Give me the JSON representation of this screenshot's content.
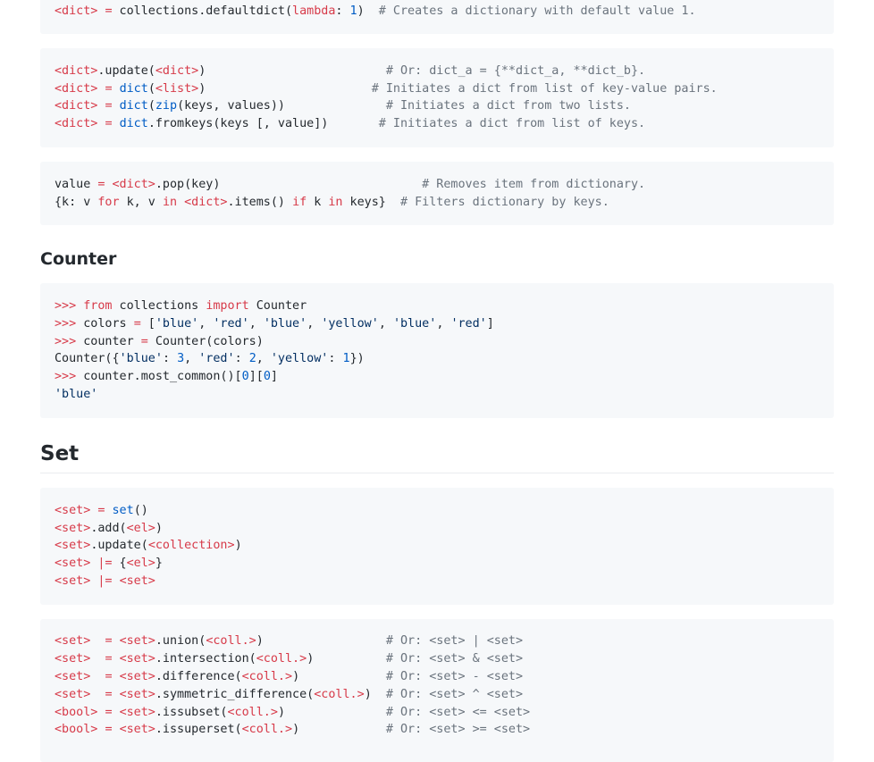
{
  "blocks": [
    {
      "name": "defaultdict-block",
      "lines": [
        [
          [
            "k",
            "<dict>"
          ],
          [
            "p",
            " "
          ],
          [
            "k",
            "="
          ],
          [
            "p",
            " collections.defaultdict("
          ],
          [
            "k",
            "lambda"
          ],
          [
            "p",
            ": "
          ],
          [
            "n",
            "1"
          ],
          [
            "p",
            ")  "
          ],
          [
            "c",
            "# Creates a dictionary with default value 1."
          ]
        ]
      ]
    },
    {
      "name": "dict-update-block",
      "lines": [
        [
          [
            "k",
            "<dict>"
          ],
          [
            "p",
            ".update("
          ],
          [
            "k",
            "<dict>"
          ],
          [
            "p",
            ")                         "
          ],
          [
            "c",
            "# Or: dict_a = {**dict_a, **dict_b}."
          ]
        ],
        [
          [
            "k",
            "<dict>"
          ],
          [
            "p",
            " "
          ],
          [
            "k",
            "="
          ],
          [
            "p",
            " "
          ],
          [
            "n",
            "dict"
          ],
          [
            "p",
            "("
          ],
          [
            "k",
            "<list>"
          ],
          [
            "p",
            ")                       "
          ],
          [
            "c",
            "# Initiates a dict from list of key-value pairs."
          ]
        ],
        [
          [
            "k",
            "<dict>"
          ],
          [
            "p",
            " "
          ],
          [
            "k",
            "="
          ],
          [
            "p",
            " "
          ],
          [
            "n",
            "dict"
          ],
          [
            "p",
            "("
          ],
          [
            "n",
            "zip"
          ],
          [
            "p",
            "(keys, values))              "
          ],
          [
            "c",
            "# Initiates a dict from two lists."
          ]
        ],
        [
          [
            "k",
            "<dict>"
          ],
          [
            "p",
            " "
          ],
          [
            "k",
            "="
          ],
          [
            "p",
            " "
          ],
          [
            "n",
            "dict"
          ],
          [
            "p",
            ".fromkeys(keys [, value])       "
          ],
          [
            "c",
            "# Initiates a dict from list of keys."
          ]
        ]
      ]
    },
    {
      "name": "dict-pop-block",
      "lines": [
        [
          [
            "p",
            "value "
          ],
          [
            "k",
            "="
          ],
          [
            "p",
            " "
          ],
          [
            "k",
            "<dict>"
          ],
          [
            "p",
            ".pop(key)                            "
          ],
          [
            "c",
            "# Removes item from dictionary."
          ]
        ],
        [
          [
            "p",
            "{k: v "
          ],
          [
            "k",
            "for"
          ],
          [
            "p",
            " k, v "
          ],
          [
            "k",
            "in"
          ],
          [
            "p",
            " "
          ],
          [
            "k",
            "<dict>"
          ],
          [
            "p",
            ".items() "
          ],
          [
            "k",
            "if"
          ],
          [
            "p",
            " k "
          ],
          [
            "k",
            "in"
          ],
          [
            "p",
            " keys}  "
          ],
          [
            "c",
            "# Filters dictionary by keys."
          ]
        ]
      ]
    },
    {
      "name": "counter-block",
      "lines": [
        [
          [
            "k",
            ">>>"
          ],
          [
            "p",
            " "
          ],
          [
            "k",
            "from"
          ],
          [
            "p",
            " collections "
          ],
          [
            "k",
            "import"
          ],
          [
            "p",
            " Counter"
          ]
        ],
        [
          [
            "k",
            ">>>"
          ],
          [
            "p",
            " colors "
          ],
          [
            "k",
            "="
          ],
          [
            "p",
            " ["
          ],
          [
            "s",
            "'blue'"
          ],
          [
            "p",
            ", "
          ],
          [
            "s",
            "'red'"
          ],
          [
            "p",
            ", "
          ],
          [
            "s",
            "'blue'"
          ],
          [
            "p",
            ", "
          ],
          [
            "s",
            "'yellow'"
          ],
          [
            "p",
            ", "
          ],
          [
            "s",
            "'blue'"
          ],
          [
            "p",
            ", "
          ],
          [
            "s",
            "'red'"
          ],
          [
            "p",
            "]"
          ]
        ],
        [
          [
            "k",
            ">>>"
          ],
          [
            "p",
            " counter "
          ],
          [
            "k",
            "="
          ],
          [
            "p",
            " Counter(colors)"
          ]
        ],
        [
          [
            "p",
            "Counter({"
          ],
          [
            "s",
            "'blue'"
          ],
          [
            "p",
            ": "
          ],
          [
            "n",
            "3"
          ],
          [
            "p",
            ", "
          ],
          [
            "s",
            "'red'"
          ],
          [
            "p",
            ": "
          ],
          [
            "n",
            "2"
          ],
          [
            "p",
            ", "
          ],
          [
            "s",
            "'yellow'"
          ],
          [
            "p",
            ": "
          ],
          [
            "n",
            "1"
          ],
          [
            "p",
            "})"
          ]
        ],
        [
          [
            "k",
            ">>>"
          ],
          [
            "p",
            " counter.most_common()["
          ],
          [
            "n",
            "0"
          ],
          [
            "p",
            "]["
          ],
          [
            "n",
            "0"
          ],
          [
            "p",
            "]"
          ]
        ],
        [
          [
            "s",
            "'blue'"
          ]
        ]
      ]
    },
    {
      "name": "set-basic-block",
      "lines": [
        [
          [
            "k",
            "<set>"
          ],
          [
            "p",
            " "
          ],
          [
            "k",
            "="
          ],
          [
            "p",
            " "
          ],
          [
            "n",
            "set"
          ],
          [
            "p",
            "()"
          ]
        ],
        [
          [
            "k",
            "<set>"
          ],
          [
            "p",
            ".add("
          ],
          [
            "k",
            "<el>"
          ],
          [
            "p",
            ")"
          ]
        ],
        [
          [
            "k",
            "<set>"
          ],
          [
            "p",
            ".update("
          ],
          [
            "k",
            "<collection>"
          ],
          [
            "p",
            ")"
          ]
        ],
        [
          [
            "k",
            "<set>"
          ],
          [
            "p",
            " "
          ],
          [
            "k",
            "|="
          ],
          [
            "p",
            " {"
          ],
          [
            "k",
            "<el>"
          ],
          [
            "p",
            "}"
          ]
        ],
        [
          [
            "k",
            "<set>"
          ],
          [
            "p",
            " "
          ],
          [
            "k",
            "|="
          ],
          [
            "p",
            " "
          ],
          [
            "k",
            "<set>"
          ]
        ]
      ]
    },
    {
      "name": "set-ops-block",
      "lines": [
        [
          [
            "k",
            "<set>"
          ],
          [
            "p",
            "  "
          ],
          [
            "k",
            "="
          ],
          [
            "p",
            " "
          ],
          [
            "k",
            "<set>"
          ],
          [
            "p",
            ".union("
          ],
          [
            "k",
            "<coll.>"
          ],
          [
            "p",
            ")                 "
          ],
          [
            "c",
            "# Or: <set> | <set>"
          ]
        ],
        [
          [
            "k",
            "<set>"
          ],
          [
            "p",
            "  "
          ],
          [
            "k",
            "="
          ],
          [
            "p",
            " "
          ],
          [
            "k",
            "<set>"
          ],
          [
            "p",
            ".intersection("
          ],
          [
            "k",
            "<coll.>"
          ],
          [
            "p",
            ")          "
          ],
          [
            "c",
            "# Or: <set> & <set>"
          ]
        ],
        [
          [
            "k",
            "<set>"
          ],
          [
            "p",
            "  "
          ],
          [
            "k",
            "="
          ],
          [
            "p",
            " "
          ],
          [
            "k",
            "<set>"
          ],
          [
            "p",
            ".difference("
          ],
          [
            "k",
            "<coll.>"
          ],
          [
            "p",
            ")            "
          ],
          [
            "c",
            "# Or: <set> - <set>"
          ]
        ],
        [
          [
            "k",
            "<set>"
          ],
          [
            "p",
            "  "
          ],
          [
            "k",
            "="
          ],
          [
            "p",
            " "
          ],
          [
            "k",
            "<set>"
          ],
          [
            "p",
            ".symmetric_difference("
          ],
          [
            "k",
            "<coll.>"
          ],
          [
            "p",
            ")  "
          ],
          [
            "c",
            "# Or: <set> ^ <set>"
          ]
        ],
        [
          [
            "k",
            "<bool>"
          ],
          [
            "p",
            " "
          ],
          [
            "k",
            "="
          ],
          [
            "p",
            " "
          ],
          [
            "k",
            "<set>"
          ],
          [
            "p",
            ".issubset("
          ],
          [
            "k",
            "<coll.>"
          ],
          [
            "p",
            ")              "
          ],
          [
            "c",
            "# Or: <set> <= <set>"
          ]
        ],
        [
          [
            "k",
            "<bool>"
          ],
          [
            "p",
            " "
          ],
          [
            "k",
            "="
          ],
          [
            "p",
            " "
          ],
          [
            "k",
            "<set>"
          ],
          [
            "p",
            ".issuperset("
          ],
          [
            "k",
            "<coll.>"
          ],
          [
            "p",
            ")            "
          ],
          [
            "c",
            "# Or: <set> >= <set>"
          ]
        ]
      ]
    }
  ],
  "headings": {
    "counter": "Counter",
    "set": "Set"
  }
}
